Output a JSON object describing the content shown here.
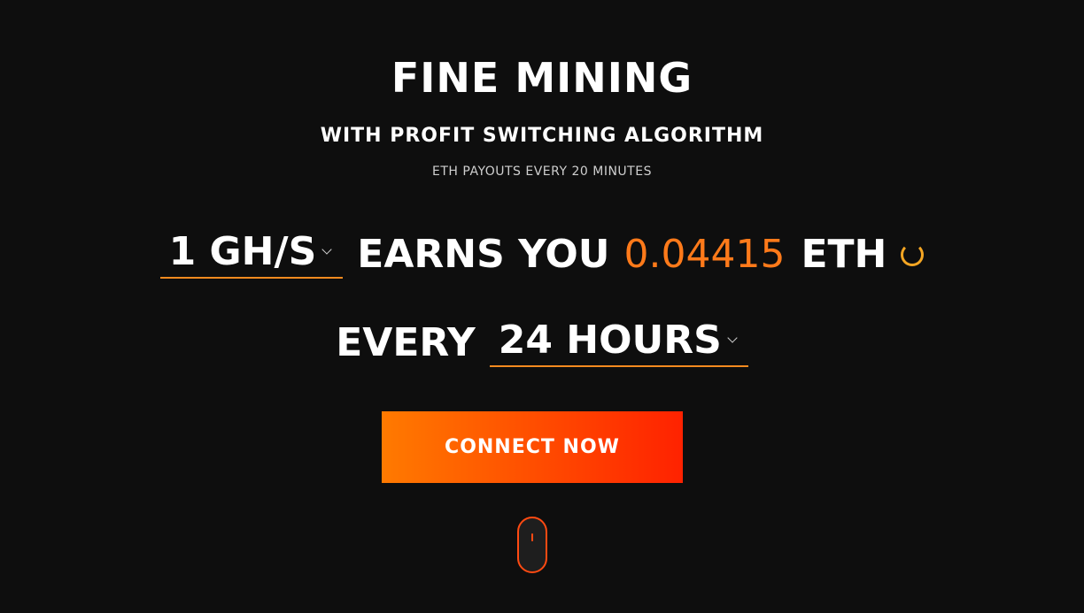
{
  "hero": {
    "title": "FINE MINING",
    "subtitle": "WITH PROFIT SWITCHING ALGORITHM",
    "payouts": "ETH PAYOUTS EVERY 20 MINUTES"
  },
  "calculator": {
    "hashrate_value": "1 GH/S",
    "earns_you_label": "EARNS YOU",
    "amount": "0.04415",
    "currency": "ETH",
    "every_label": "EVERY",
    "period_value": "24 HOURS"
  },
  "cta": {
    "connect_label": "CONNECT NOW"
  },
  "colors": {
    "background": "#0e0e0e",
    "accent_orange": "#ff7a1a",
    "underline": "#f58a1f",
    "button_gradient_start": "#ff7a00",
    "button_gradient_end": "#ff2200"
  },
  "icons": {
    "dropdown": "chevron-down-icon",
    "loading": "spinner-icon",
    "scroll": "mouse-scroll-icon"
  }
}
